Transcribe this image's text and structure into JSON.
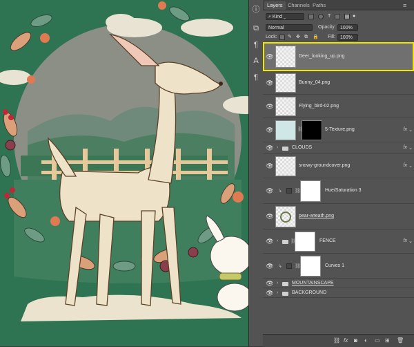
{
  "panel": {
    "tabs": [
      "Layers",
      "Channels",
      "Paths"
    ],
    "active_tab": "Layers",
    "filter": {
      "kind_label": "Kind"
    },
    "blend_mode": "Normal",
    "opacity_label": "Opacity:",
    "opacity_value": "100%",
    "lock_label": "Lock:",
    "fill_label": "Fill:",
    "fill_value": "100%"
  },
  "layers": [
    {
      "name": "Deer_looking_up.png",
      "selected": true
    },
    {
      "name": "Bunny_04.png"
    },
    {
      "name": "Flying_bird-02.png"
    },
    {
      "name": "5-Texture.png",
      "fx": "fx"
    },
    {
      "name": "CLOUDS",
      "fx": "fx"
    },
    {
      "name": "snowy-groundcover.png",
      "fx": "fx"
    },
    {
      "name": "Hue/Saturation 3"
    },
    {
      "name": "pear-wreath.png"
    },
    {
      "name": "FENCE",
      "fx": "fx"
    },
    {
      "name": "Curves 1"
    },
    {
      "name": "MOUNTAINSCAPE"
    },
    {
      "name": "BACKGROUND"
    }
  ],
  "colors": {
    "panel_bg": "#535353",
    "selection_border": "#f2e600",
    "canvas_green": "#2f7a55"
  },
  "icons": {
    "search": "search-icon",
    "eye": "eye-icon",
    "folder": "folder-icon",
    "link": "link-icon",
    "trash": "trash-icon"
  }
}
